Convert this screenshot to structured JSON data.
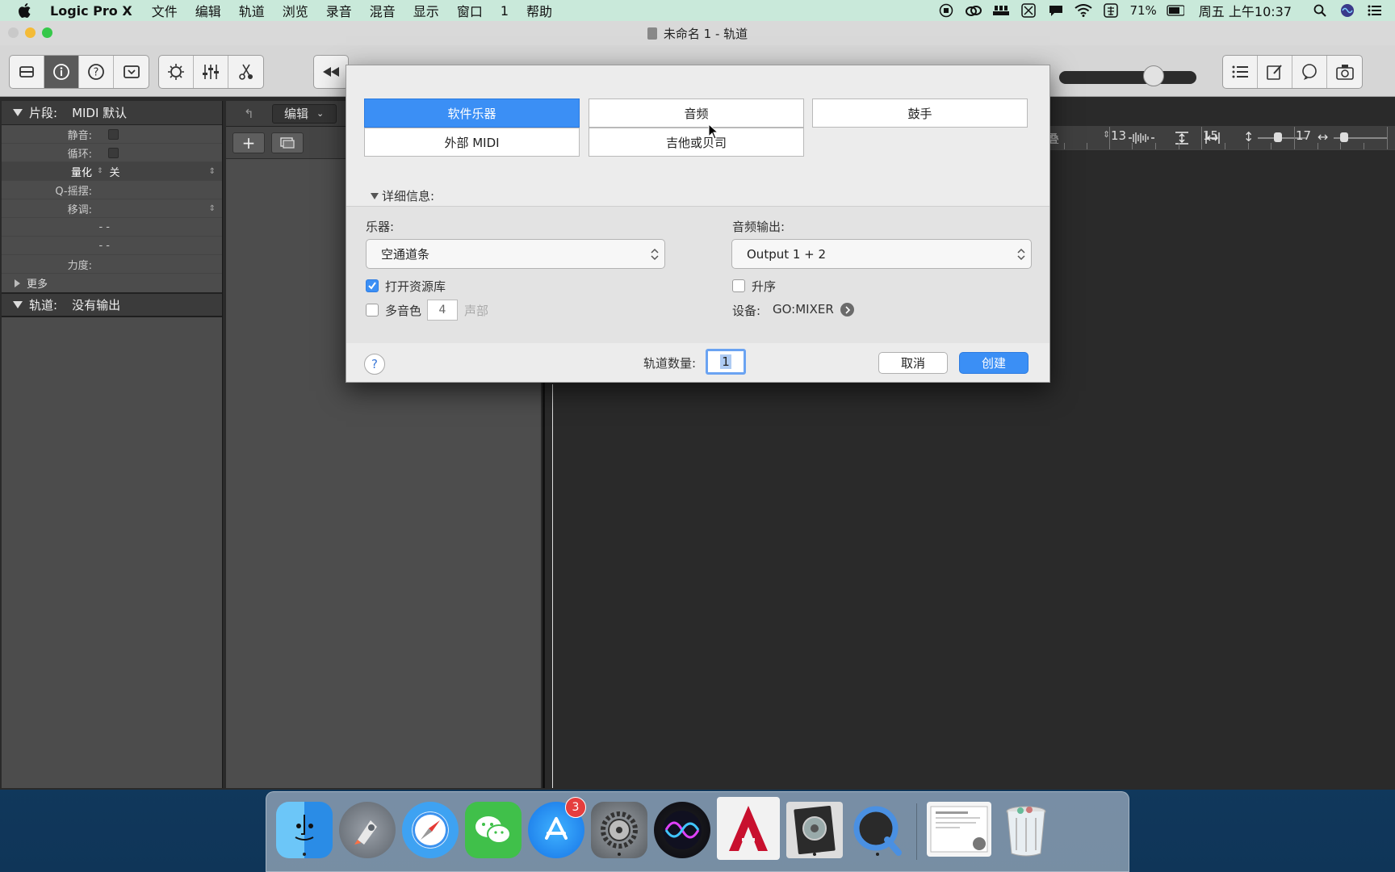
{
  "menubar": {
    "app": "Logic Pro X",
    "items": [
      "文件",
      "编辑",
      "轨道",
      "浏览",
      "录音",
      "混音",
      "显示",
      "窗口",
      "1",
      "帮助"
    ],
    "battery": "71%",
    "clock": "周五 上午10:37"
  },
  "window": {
    "title": "未命名 1 - 轨道"
  },
  "inspector": {
    "region_label": "片段:",
    "region_value": "MIDI 默认",
    "rows": [
      {
        "k": "静音:"
      },
      {
        "k": "循环:"
      },
      {
        "k": "量化",
        "v": "关"
      },
      {
        "k": "Q-摇摆:"
      },
      {
        "k": "移调:"
      },
      {
        "k": "- -"
      },
      {
        "k": "- -"
      },
      {
        "k": "力度:"
      }
    ],
    "more": "更多",
    "track_label": "轨道:",
    "track_value": "没有输出"
  },
  "tracklist": {
    "edit_menu": "编辑",
    "add_symbol": "+"
  },
  "ruler": [
    "13",
    "15",
    "17"
  ],
  "dialog": {
    "types": {
      "software_instrument": "软件乐器",
      "audio": "音频",
      "drummer": "鼓手",
      "external_midi": "外部 MIDI",
      "guitar_bass": "吉他或贝司"
    },
    "details_label": "详细信息:",
    "instrument_label": "乐器:",
    "instrument_value": "空通道条",
    "audio_output_label": "音频输出:",
    "audio_output_value": "Output 1 + 2",
    "open_library_label": "打开资源库",
    "open_library_checked": true,
    "multitimbral_label": "多音色",
    "multitimbral_count": "4",
    "parts_label": "声部",
    "ascending_label": "升序",
    "device_label": "设备:",
    "device_value": "GO:MIXER",
    "help": "?",
    "track_count_label": "轨道数量:",
    "track_count_value": "1",
    "cancel": "取消",
    "create": "创建"
  },
  "dock": {
    "items": [
      "finder-icon",
      "launchpad-icon",
      "safari-icon",
      "wechat-icon",
      "app-store-icon",
      "system-preferences-icon",
      "siri-icon",
      "autocad-icon",
      "logic-pro-icon",
      "quicktime-icon",
      "preview-document-icon",
      "trash-icon"
    ],
    "app_store_badge": "3"
  },
  "colors": {
    "accent_blue": "#3b8ff5",
    "menubar_bg": "#c9e9da",
    "inspector_bg": "#4c4c4c"
  }
}
